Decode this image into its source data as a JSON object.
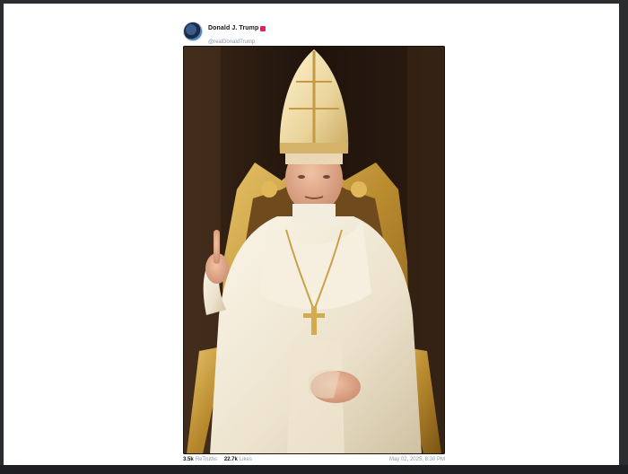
{
  "post": {
    "display_name": "Donald J. Trump",
    "handle": "@realDonaldTrump",
    "image_alt": "Figure in white papal vestments and gold mitre seated on ornate gold throne, index finger raised",
    "stats": {
      "retruths_count": "3.5k",
      "retruths_label": "ReTruths",
      "likes_count": "22.7k",
      "likes_label": "Likes"
    },
    "timestamp": "May 02, 2025, 8:30 PM"
  },
  "colors": {
    "background": "#2b2d31",
    "card": "#ffffff",
    "verified_badge": "#e0245e"
  }
}
